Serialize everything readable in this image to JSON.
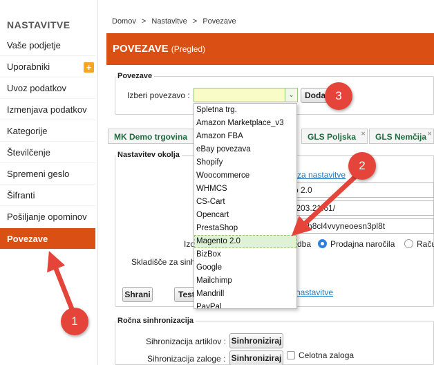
{
  "sidebar": {
    "title": "NASTAVITVE",
    "items": [
      {
        "label": "Vaše podjetje"
      },
      {
        "label": "Uporabniki"
      },
      {
        "label": "Uvoz podatkov"
      },
      {
        "label": "Izmenjava podatkov"
      },
      {
        "label": "Kategorije"
      },
      {
        "label": "Številčenje"
      },
      {
        "label": "Spremeni geslo"
      },
      {
        "label": "Šifranti"
      },
      {
        "label": "Pošiljanje opominov"
      },
      {
        "label": "Povezave"
      }
    ],
    "add_icon": "+"
  },
  "breadcrumb": {
    "items": [
      "Domov",
      ">",
      "Nastavitve",
      ">",
      "Povezave"
    ]
  },
  "header": {
    "title": "POVEZAVE",
    "subtitle": "(Pregled)"
  },
  "povezave": {
    "legend": "Povezave",
    "select_label": "Izberi povezavo :",
    "select_value": "",
    "arrow": "⌄",
    "add_button": "Dodaj"
  },
  "tabs": [
    {
      "label": "MK Demo trgovina"
    },
    {
      "label": "GLS Poljska"
    },
    {
      "label": "GLS Nemčija"
    }
  ],
  "nastavitev": {
    "legend": "Nastavitev okolja",
    "link_top": "za nastavitve",
    "value1": "o 2.0",
    "value2": ".203.2​1.61/",
    "value3": "460h8cl4vvyneoesn3pl8t",
    "izdelek_label": "Izo",
    "dba_label": "dba",
    "radio1_label": "Prodajna naročila",
    "radio2_label": "Raču",
    "skladisce_label": "Skladišče za sinh",
    "shrani_button": "Shrani",
    "test_button": "Test",
    "link_bottom": "nastavitve"
  },
  "rocna": {
    "legend": "Ročna sinhronizacija",
    "artikli_label": "Sihronizacija artiklov :",
    "zaloge_label": "Sihronizacija zaloge :",
    "sync_button": "Sinhroniziraj",
    "celotna_label": "Celotna zaloga"
  },
  "dropdown": {
    "options": [
      "Spletna trg.",
      "Amazon Marketplace_v3",
      "Amazon FBA",
      "eBay povezava",
      "Shopify",
      "Woocommerce",
      "WHMCS",
      "CS-Cart",
      "Opencart",
      "PrestaShop",
      "Magento 2.0",
      "BizBox",
      "Google",
      "Mailchimp",
      "Mandrill",
      "PayPal"
    ],
    "selected": "Magento 2.0"
  },
  "annotations": {
    "badge1": "1",
    "badge2": "2",
    "badge3": "3",
    "color": "#e5443a"
  },
  "colors": {
    "accent": "#d94f14",
    "tab_text": "#1f6b3f",
    "link": "#1f7ac4"
  }
}
